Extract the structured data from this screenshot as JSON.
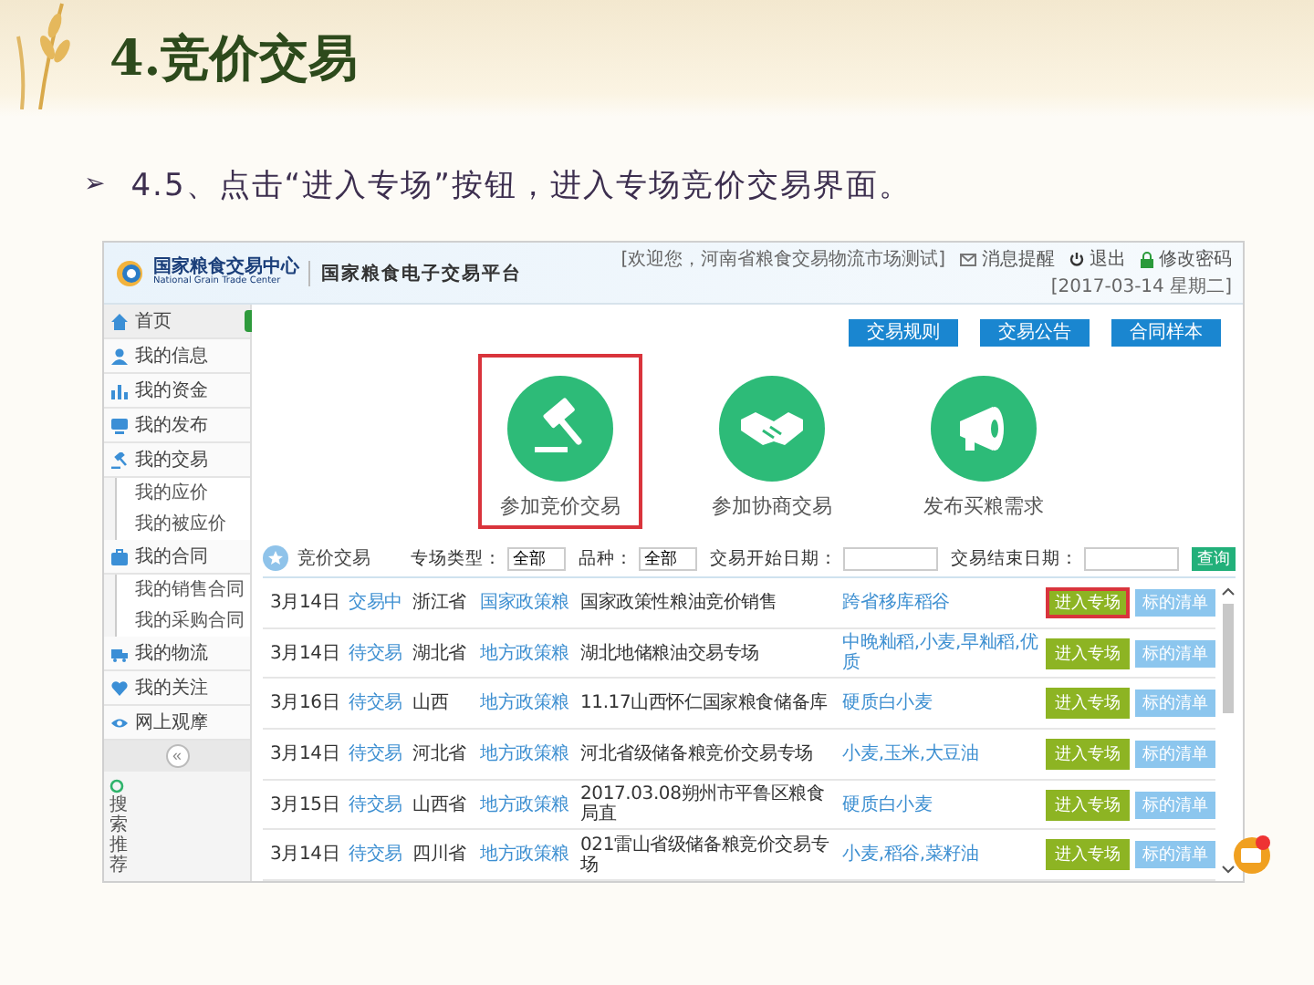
{
  "slide": {
    "title": "4.竞价交易",
    "bullet": "➢",
    "subtitle": "4.5、点击“进入专场”按钮，进入专场竞价交易界面。"
  },
  "app": {
    "logo": {
      "name": "国家粮食交易中心",
      "english": "National Grain Trade Center"
    },
    "platform_title": "国家粮食电子交易平台",
    "welcome": "[欢迎您，河南省粮食交易物流市场测试]",
    "header_links": [
      {
        "kind": "message",
        "label": "消息提醒"
      },
      {
        "kind": "logout",
        "label": "退出"
      },
      {
        "kind": "password",
        "label": "修改密码"
      }
    ],
    "date": "[2017-03-14 星期二]",
    "sidebar": [
      {
        "kind": "home",
        "label": "首页",
        "selected": true
      },
      {
        "kind": "user",
        "label": "我的信息",
        "selected": false
      },
      {
        "kind": "money",
        "label": "我的资金",
        "selected": false
      },
      {
        "kind": "publish",
        "label": "我的发布",
        "selected": false
      },
      {
        "kind": "trade",
        "label": "我的交易",
        "selected": false,
        "children": [
          {
            "label": "我的应价",
            "selected": false
          },
          {
            "label": "我的被应价",
            "selected": false
          }
        ]
      },
      {
        "kind": "contract",
        "label": "我的合同",
        "selected": false,
        "children": [
          {
            "label": "我的销售合同",
            "selected": false
          },
          {
            "label": "我的采购合同",
            "selected": false
          }
        ]
      },
      {
        "kind": "logistics",
        "label": "我的物流",
        "selected": false
      },
      {
        "kind": "heart",
        "label": "我的关注",
        "selected": false
      },
      {
        "kind": "eye",
        "label": "网上观摩",
        "selected": false
      }
    ],
    "collapse": "«",
    "search_recommend": "搜索推荐",
    "top_buttons": [
      "交易规则",
      "交易公告",
      "合同样本"
    ],
    "actions": [
      {
        "kind": "gavel",
        "label": "参加竞价交易",
        "highlighted": true
      },
      {
        "kind": "handshake",
        "label": "参加协商交易",
        "highlighted": false
      },
      {
        "kind": "megaphone",
        "label": "发布买粮需求",
        "highlighted": false
      }
    ],
    "section_title": "竞价交易",
    "filters": [
      {
        "label": "专场类型：",
        "value": "全部"
      },
      {
        "label": "品种：",
        "value": "全部"
      },
      {
        "label": "交易开始日期："
      },
      {
        "label": "交易结束日期："
      }
    ],
    "search_button": "查询",
    "rows": [
      {
        "date": "3月14日",
        "status": "交易中",
        "province": "浙江省",
        "type": "国家政策粮",
        "name": "国家政策性粮油竞价销售",
        "variety": "跨省移库稻谷",
        "enter": "进入专场",
        "list": "标的清单",
        "highlighted": true
      },
      {
        "date": "3月14日",
        "status": "待交易",
        "province": "湖北省",
        "type": "地方政策粮",
        "name": "湖北地储粮油交易专场",
        "variety": "中晚籼稻,小麦,早籼稻,优质",
        "enter": "进入专场",
        "list": "标的清单",
        "highlighted": false
      },
      {
        "date": "3月16日",
        "status": "待交易",
        "province": "山西",
        "type": "地方政策粮",
        "name": "11.17山西怀仁国家粮食储备库",
        "variety": "硬质白小麦",
        "enter": "进入专场",
        "list": "标的清单",
        "highlighted": false
      },
      {
        "date": "3月14日",
        "status": "待交易",
        "province": "河北省",
        "type": "地方政策粮",
        "name": "河北省级储备粮竞价交易专场",
        "variety": "小麦,玉米,大豆油",
        "enter": "进入专场",
        "list": "标的清单",
        "highlighted": false
      },
      {
        "date": "3月15日",
        "status": "待交易",
        "province": "山西省",
        "type": "地方政策粮",
        "name": "2017.03.08朔州市平鲁区粮食局直",
        "variety": "硬质白小麦",
        "enter": "进入专场",
        "list": "标的清单",
        "highlighted": false
      },
      {
        "date": "3月14日",
        "status": "待交易",
        "province": "四川省",
        "type": "地方政策粮",
        "name": "021雷山省级储备粮竞价交易专场",
        "variety": "小麦,稻谷,菜籽油",
        "enter": "进入专场",
        "list": "标的清单",
        "highlighted": false
      }
    ]
  }
}
